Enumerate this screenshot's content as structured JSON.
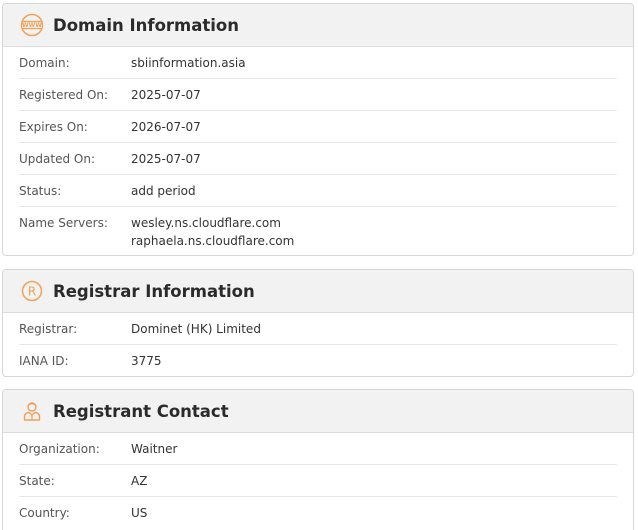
{
  "colors": {
    "accent": "#f0a15a",
    "header_bg": "#f2f2f2",
    "border": "#d6d6d6"
  },
  "domain_card": {
    "title": "Domain Information",
    "icon": "www-icon",
    "rows": [
      {
        "label": "Domain:",
        "value": "sbiinformation.asia"
      },
      {
        "label": "Registered On:",
        "value": "2025-07-07"
      },
      {
        "label": "Expires On:",
        "value": "2026-07-07"
      },
      {
        "label": "Updated On:",
        "value": "2025-07-07"
      },
      {
        "label": "Status:",
        "value": "add period"
      }
    ],
    "name_servers": {
      "label": "Name Servers:",
      "values": [
        "wesley.ns.cloudflare.com",
        "raphaela.ns.cloudflare.com"
      ]
    }
  },
  "registrar_card": {
    "title": "Registrar Information",
    "icon": "registered-icon",
    "rows": [
      {
        "label": "Registrar:",
        "value": "Dominet (HK) Limited"
      },
      {
        "label": "IANA ID:",
        "value": "3775"
      }
    ]
  },
  "registrant_card": {
    "title": "Registrant Contact",
    "icon": "person-icon",
    "rows": [
      {
        "label": "Organization:",
        "value": "Waitner"
      },
      {
        "label": "State:",
        "value": "AZ"
      },
      {
        "label": "Country:",
        "value": "US"
      }
    ]
  }
}
